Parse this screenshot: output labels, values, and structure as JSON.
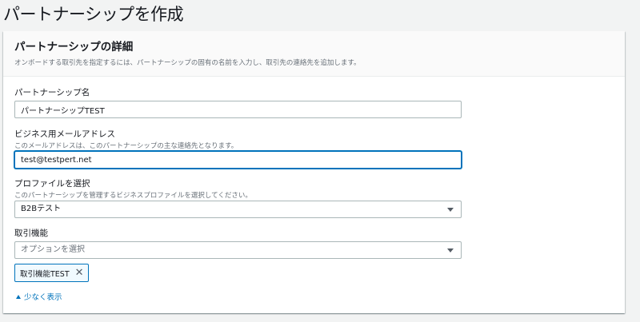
{
  "page": {
    "title": "パートナーシップを作成"
  },
  "panel": {
    "title": "パートナーシップの詳細",
    "description": "オンボードする取引先を指定するには、パートナーシップの固有の名前を入力し、取引先の連絡先を追加します。"
  },
  "fields": {
    "partnership_name": {
      "label": "パートナーシップ名",
      "value": "パートナーシップTEST"
    },
    "business_email": {
      "label": "ビジネス用メールアドレス",
      "description": "このメールアドレスは、このパートナーシップの主な連絡先となります。",
      "value": "test@testpert.net"
    },
    "profile": {
      "label": "プロファイルを選択",
      "description": "このパートナーシップを管理するビジネスプロファイルを選択してください。",
      "selected": "B2Bテスト"
    },
    "capabilities": {
      "label": "取引機能",
      "placeholder": "オプションを選択",
      "tokens": [
        {
          "label": "取引機能TEST"
        }
      ]
    }
  },
  "show_less": {
    "label": "少なく表示"
  },
  "colors": {
    "link": "#0073bb",
    "focus_border": "#0073bb",
    "background": "#f2f3f3"
  }
}
